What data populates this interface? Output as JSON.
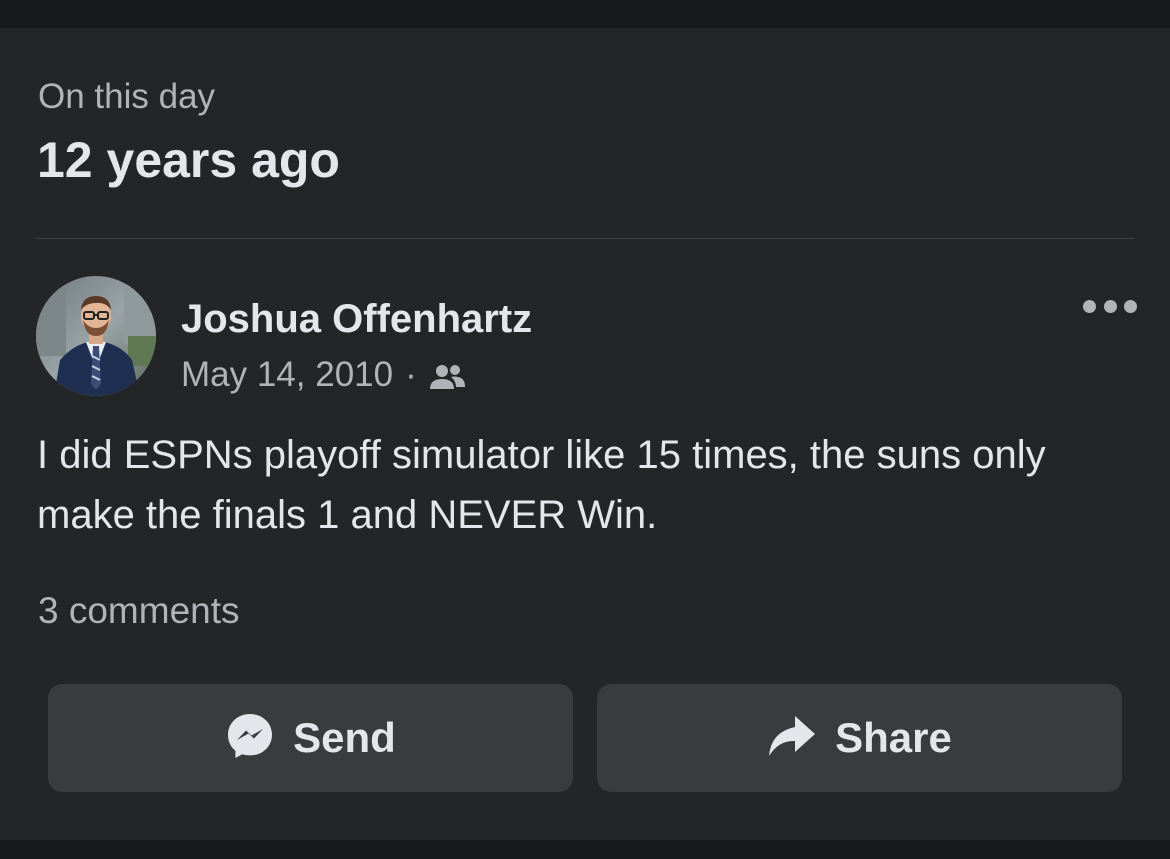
{
  "memory": {
    "eyebrow": "On this day",
    "headline": "12 years ago"
  },
  "post": {
    "author": "Joshua Offenhartz",
    "date": "May 14, 2010",
    "separator": "·",
    "audience_icon": "friends-icon",
    "text": "I did ESPNs playoff simulator like 15 times, the suns only make the finals 1 and NEVER Win.",
    "comments": "3 comments"
  },
  "actions": {
    "send_label": "Send",
    "send_icon": "messenger-icon",
    "share_label": "Share",
    "share_icon": "share-arrow-icon"
  },
  "colors": {
    "card_bg": "#242526",
    "page_bg": "#18191a",
    "button_bg": "#3a3b3c",
    "primary_text": "#e4e6eb",
    "secondary_text": "#b0b3b8"
  }
}
